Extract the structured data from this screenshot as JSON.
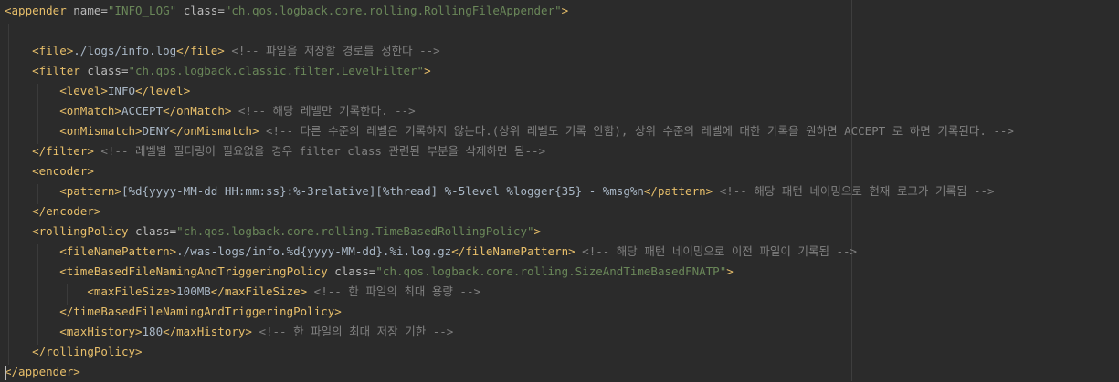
{
  "editor": {
    "lines": [
      [
        [
          "tag",
          "<appender "
        ],
        [
          "attr",
          "name="
        ],
        [
          "str",
          "\"INFO_LOG\""
        ],
        [
          "attr",
          " class="
        ],
        [
          "str",
          "\"ch.qos.logback.core.rolling.RollingFileAppender\""
        ],
        [
          "tag",
          ">"
        ]
      ],
      [],
      [
        [
          "txt",
          "    "
        ],
        [
          "tag",
          "<file>"
        ],
        [
          "txt",
          "./logs/info.log"
        ],
        [
          "tag",
          "</file>"
        ],
        [
          "cmt",
          " <!-- 파일을 저장할 경로를 정한다 -->"
        ]
      ],
      [
        [
          "txt",
          "    "
        ],
        [
          "tag",
          "<filter "
        ],
        [
          "attr",
          "class="
        ],
        [
          "str",
          "\"ch.qos.logback.classic.filter.LevelFilter\""
        ],
        [
          "tag",
          ">"
        ]
      ],
      [
        [
          "txt",
          "        "
        ],
        [
          "tag",
          "<level>"
        ],
        [
          "txt",
          "INFO"
        ],
        [
          "tag",
          "</level>"
        ]
      ],
      [
        [
          "txt",
          "        "
        ],
        [
          "tag",
          "<onMatch>"
        ],
        [
          "txt",
          "ACCEPT"
        ],
        [
          "tag",
          "</onMatch>"
        ],
        [
          "cmt",
          " <!-- 해당 레벨만 기록한다. -->"
        ]
      ],
      [
        [
          "txt",
          "        "
        ],
        [
          "tag",
          "<onMismatch>"
        ],
        [
          "txt",
          "DENY"
        ],
        [
          "tag",
          "</onMismatch>"
        ],
        [
          "cmt",
          " <!-- 다른 수준의 레벨은 기록하지 않는다.(상위 레벨도 기록 안함), 상위 수준의 레벨에 대한 기록을 원하면 ACCEPT 로 하면 기록된다. -->"
        ]
      ],
      [
        [
          "txt",
          "    "
        ],
        [
          "tag",
          "</filter>"
        ],
        [
          "cmt",
          " <!-- 레벨별 필터링이 필요없을 경우 filter class 관련된 부분을 삭제하면 됨-->"
        ]
      ],
      [
        [
          "txt",
          "    "
        ],
        [
          "tag",
          "<encoder>"
        ]
      ],
      [
        [
          "txt",
          "        "
        ],
        [
          "tag",
          "<pattern>"
        ],
        [
          "txt",
          "[%d{yyyy-MM-dd HH:mm:ss}:%-3relative][%thread] %-5level %logger{35} - %msg%n"
        ],
        [
          "tag",
          "</pattern>"
        ],
        [
          "cmt",
          " <!-- 해당 패턴 네이밍으로 현재 로그가 기록됨 -->"
        ]
      ],
      [
        [
          "txt",
          "    "
        ],
        [
          "tag",
          "</encoder>"
        ]
      ],
      [
        [
          "txt",
          "    "
        ],
        [
          "tag",
          "<rollingPolicy "
        ],
        [
          "attr",
          "class="
        ],
        [
          "str",
          "\"ch.qos.logback.core.rolling.TimeBasedRollingPolicy\""
        ],
        [
          "tag",
          ">"
        ]
      ],
      [
        [
          "txt",
          "        "
        ],
        [
          "tag",
          "<fileNamePattern>"
        ],
        [
          "txt",
          "./was-logs/info.%d{yyyy-MM-dd}.%i.log.gz"
        ],
        [
          "tag",
          "</fileNamePattern>"
        ],
        [
          "cmt",
          " <!-- 해당 패턴 네이밍으로 이전 파일이 기록됨 -->"
        ]
      ],
      [
        [
          "txt",
          "        "
        ],
        [
          "tag",
          "<timeBasedFileNamingAndTriggeringPolicy "
        ],
        [
          "attr",
          "class="
        ],
        [
          "str",
          "\"ch.qos.logback.core.rolling.SizeAndTimeBasedFNATP\""
        ],
        [
          "tag",
          ">"
        ]
      ],
      [
        [
          "txt",
          "            "
        ],
        [
          "tag",
          "<maxFileSize>"
        ],
        [
          "txt",
          "100MB"
        ],
        [
          "tag",
          "</maxFileSize>"
        ],
        [
          "cmt",
          " <!-- 한 파일의 최대 용량 -->"
        ]
      ],
      [
        [
          "txt",
          "        "
        ],
        [
          "tag",
          "</timeBasedFileNamingAndTriggeringPolicy>"
        ]
      ],
      [
        [
          "txt",
          "        "
        ],
        [
          "tag",
          "<maxHistory>"
        ],
        [
          "txt",
          "180"
        ],
        [
          "tag",
          "</maxHistory>"
        ],
        [
          "cmt",
          " <!-- 한 파일의 최대 저장 기한 -->"
        ]
      ],
      [
        [
          "txt",
          "    "
        ],
        [
          "tag",
          "</rollingPolicy>"
        ]
      ],
      [
        [
          "tag",
          "</appender>"
        ]
      ]
    ]
  }
}
